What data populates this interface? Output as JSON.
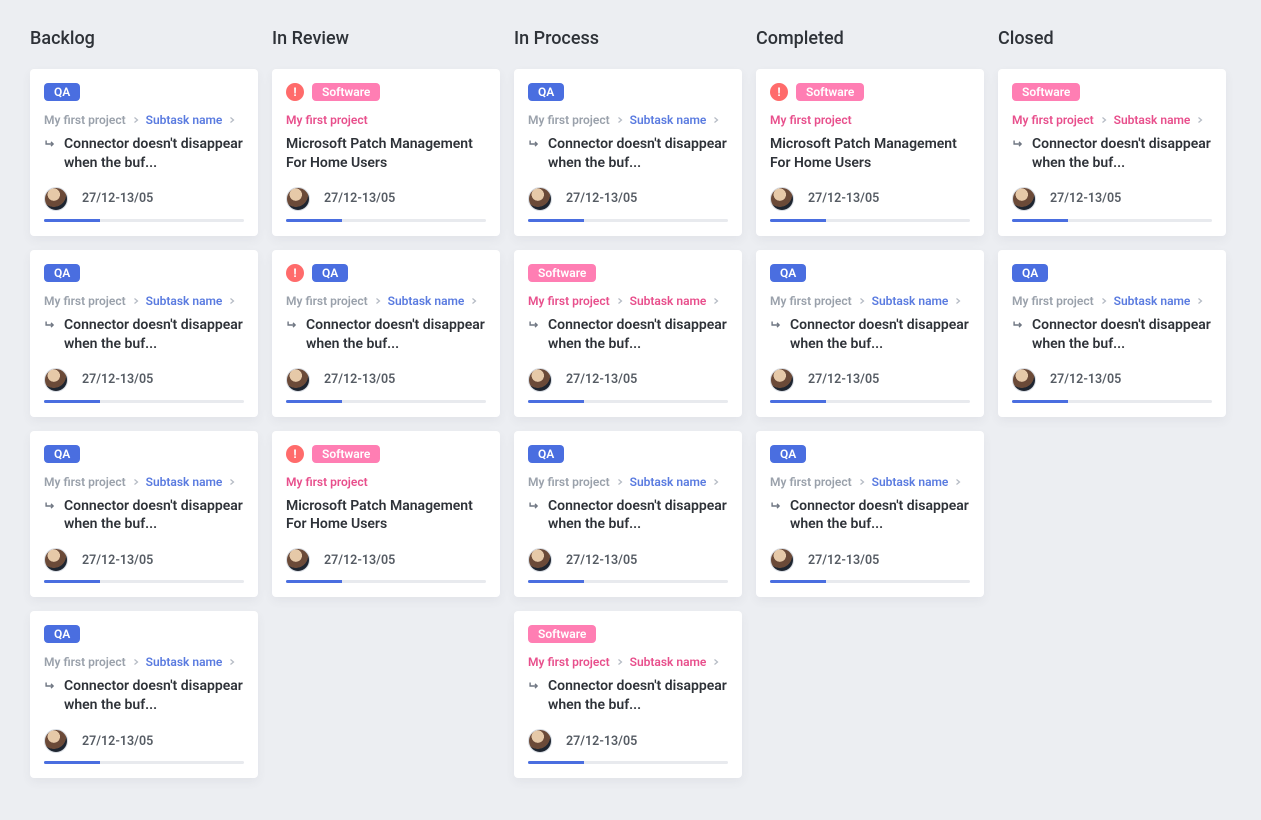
{
  "columns": [
    {
      "title": "Backlog",
      "cards": [
        {
          "alert": false,
          "tag": "QA",
          "tag_class": "qa",
          "pink_crumb": false,
          "project": "My first project",
          "subtask": "Subtask name",
          "show_subtask": true,
          "show_arrow": true,
          "title": "Connector doesn't disappear when the buf...",
          "dates": "27/12-13/05",
          "progress": 28
        },
        {
          "alert": false,
          "tag": "QA",
          "tag_class": "qa",
          "pink_crumb": false,
          "project": "My first project",
          "subtask": "Subtask name",
          "show_subtask": true,
          "show_arrow": true,
          "title": "Connector doesn't disappear when the buf...",
          "dates": "27/12-13/05",
          "progress": 28
        },
        {
          "alert": false,
          "tag": "QA",
          "tag_class": "qa",
          "pink_crumb": false,
          "project": "My first project",
          "subtask": "Subtask name",
          "show_subtask": true,
          "show_arrow": true,
          "title": "Connector doesn't disappear when the buf...",
          "dates": "27/12-13/05",
          "progress": 28
        },
        {
          "alert": false,
          "tag": "QA",
          "tag_class": "qa",
          "pink_crumb": false,
          "project": "My first project",
          "subtask": "Subtask name",
          "show_subtask": true,
          "show_arrow": true,
          "title": "Connector doesn't disappear when the buf...",
          "dates": "27/12-13/05",
          "progress": 28
        }
      ]
    },
    {
      "title": "In Review",
      "cards": [
        {
          "alert": true,
          "tag": "Software",
          "tag_class": "software",
          "pink_crumb": true,
          "project": "My first project",
          "subtask": "",
          "show_subtask": false,
          "show_arrow": false,
          "title": "Microsoft Patch Management For Home Users",
          "dates": "27/12-13/05",
          "progress": 28
        },
        {
          "alert": true,
          "tag": "QA",
          "tag_class": "qa",
          "pink_crumb": false,
          "project": "My first project",
          "subtask": "Subtask name",
          "show_subtask": true,
          "show_arrow": true,
          "title": "Connector doesn't disappear when the buf...",
          "dates": "27/12-13/05",
          "progress": 28
        },
        {
          "alert": true,
          "tag": "Software",
          "tag_class": "software",
          "pink_crumb": true,
          "project": "My first project",
          "subtask": "",
          "show_subtask": false,
          "show_arrow": false,
          "title": "Microsoft Patch Management For Home Users",
          "dates": "27/12-13/05",
          "progress": 28
        }
      ]
    },
    {
      "title": "In Process",
      "cards": [
        {
          "alert": false,
          "tag": "QA",
          "tag_class": "qa",
          "pink_crumb": false,
          "project": "My first project",
          "subtask": "Subtask name",
          "show_subtask": true,
          "show_arrow": true,
          "title": "Connector doesn't disappear when the buf...",
          "dates": "27/12-13/05",
          "progress": 28
        },
        {
          "alert": false,
          "tag": "Software",
          "tag_class": "software",
          "pink_crumb": true,
          "project": "My first project",
          "subtask": "Subtask name",
          "show_subtask": true,
          "show_arrow": true,
          "title": "Connector doesn't disappear when the buf...",
          "dates": "27/12-13/05",
          "progress": 28
        },
        {
          "alert": false,
          "tag": "QA",
          "tag_class": "qa",
          "pink_crumb": false,
          "project": "My first project",
          "subtask": "Subtask name",
          "show_subtask": true,
          "show_arrow": true,
          "title": "Connector doesn't disappear when the buf...",
          "dates": "27/12-13/05",
          "progress": 28
        },
        {
          "alert": false,
          "tag": "Software",
          "tag_class": "software",
          "pink_crumb": true,
          "project": "My first project",
          "subtask": "Subtask name",
          "show_subtask": true,
          "show_arrow": true,
          "title": "Connector doesn't disappear when the buf...",
          "dates": "27/12-13/05",
          "progress": 28
        }
      ]
    },
    {
      "title": "Completed",
      "cards": [
        {
          "alert": true,
          "tag": "Software",
          "tag_class": "software",
          "pink_crumb": true,
          "project": "My first project",
          "subtask": "",
          "show_subtask": false,
          "show_arrow": false,
          "title": "Microsoft Patch Management For Home Users",
          "dates": "27/12-13/05",
          "progress": 28
        },
        {
          "alert": false,
          "tag": "QA",
          "tag_class": "qa",
          "pink_crumb": false,
          "project": "My first project",
          "subtask": "Subtask name",
          "show_subtask": true,
          "show_arrow": true,
          "title": "Connector doesn't disappear when the buf...",
          "dates": "27/12-13/05",
          "progress": 28
        },
        {
          "alert": false,
          "tag": "QA",
          "tag_class": "qa",
          "pink_crumb": false,
          "project": "My first project",
          "subtask": "Subtask name",
          "show_subtask": true,
          "show_arrow": true,
          "title": "Connector doesn't disappear when the buf...",
          "dates": "27/12-13/05",
          "progress": 28
        }
      ]
    },
    {
      "title": "Closed",
      "cards": [
        {
          "alert": false,
          "tag": "Software",
          "tag_class": "software",
          "pink_crumb": true,
          "project": "My first project",
          "subtask": "Subtask name",
          "show_subtask": true,
          "show_arrow": true,
          "title": "Connector doesn't disappear when the buf...",
          "dates": "27/12-13/05",
          "progress": 28
        },
        {
          "alert": false,
          "tag": "QA",
          "tag_class": "qa",
          "pink_crumb": false,
          "project": "My first project",
          "subtask": "Subtask name",
          "show_subtask": true,
          "show_arrow": true,
          "title": "Connector doesn't disappear when the buf...",
          "dates": "27/12-13/05",
          "progress": 28
        }
      ]
    }
  ]
}
